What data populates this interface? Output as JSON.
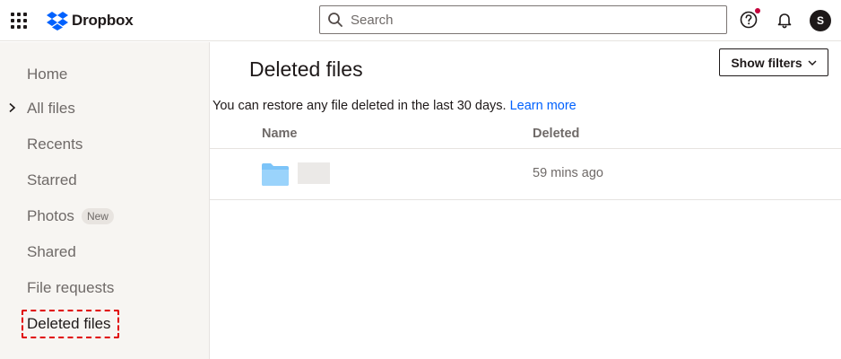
{
  "app": {
    "name": "Dropbox"
  },
  "search": {
    "placeholder": "Search",
    "value": ""
  },
  "header_icons": [
    "apps-grid-icon",
    "help-icon",
    "bell-icon"
  ],
  "user": {
    "initial": "S"
  },
  "sidebar": {
    "items": [
      {
        "label": "Home"
      },
      {
        "label": "All files"
      },
      {
        "label": "Recents"
      },
      {
        "label": "Starred"
      },
      {
        "label": "Photos",
        "badge": "New"
      },
      {
        "label": "Shared"
      },
      {
        "label": "File requests"
      },
      {
        "label": "Deleted files"
      }
    ]
  },
  "main": {
    "title": "Deleted files",
    "filters_label": "Show filters",
    "info_text": "You can restore any file deleted in the last 30 days.",
    "learn_more": "Learn more",
    "columns": {
      "name": "Name",
      "deleted": "Deleted"
    },
    "rows": [
      {
        "type": "folder",
        "name": "",
        "deleted": "59 mins ago"
      }
    ]
  },
  "colors": {
    "accent": "#0061fe",
    "sidebar_bg": "#f7f5f2",
    "highlight": "#e00000",
    "folder": "#7cc4f8"
  }
}
